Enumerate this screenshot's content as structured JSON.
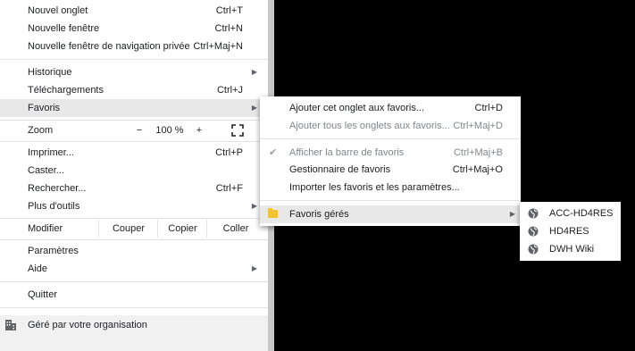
{
  "menu": {
    "new_tab": {
      "label": "Nouvel onglet",
      "shortcut": "Ctrl+T"
    },
    "new_window": {
      "label": "Nouvelle fenêtre",
      "shortcut": "Ctrl+N"
    },
    "incognito": {
      "label": "Nouvelle fenêtre de navigation privée",
      "shortcut": "Ctrl+Maj+N"
    },
    "history": {
      "label": "Historique"
    },
    "downloads": {
      "label": "Téléchargements",
      "shortcut": "Ctrl+J"
    },
    "bookmarks": {
      "label": "Favoris"
    },
    "zoom": {
      "label": "Zoom",
      "minus": "−",
      "value": "100 %",
      "plus": "+"
    },
    "print": {
      "label": "Imprimer...",
      "shortcut": "Ctrl+P"
    },
    "cast": {
      "label": "Caster..."
    },
    "find": {
      "label": "Rechercher...",
      "shortcut": "Ctrl+F"
    },
    "more_tools": {
      "label": "Plus d'outils"
    },
    "edit": {
      "label": "Modifier",
      "cut": "Couper",
      "copy": "Copier",
      "paste": "Coller"
    },
    "settings": {
      "label": "Paramètres"
    },
    "help": {
      "label": "Aide"
    },
    "quit": {
      "label": "Quitter"
    },
    "managed": {
      "label": "Géré par votre organisation"
    }
  },
  "bookmarks_submenu": {
    "add_tab": {
      "label": "Ajouter cet onglet aux favoris...",
      "shortcut": "Ctrl+D"
    },
    "add_all": {
      "label": "Ajouter tous les onglets aux favoris...",
      "shortcut": "Ctrl+Maj+D"
    },
    "show_bar": {
      "label": "Afficher la barre de favoris",
      "shortcut": "Ctrl+Maj+B"
    },
    "manager": {
      "label": "Gestionnaire de favoris",
      "shortcut": "Ctrl+Maj+O"
    },
    "import": {
      "label": "Importer les favoris et les paramètres..."
    },
    "managed_folder": {
      "label": "Favoris gérés"
    }
  },
  "managed_bookmarks": [
    {
      "label": "ACC-HD4RES"
    },
    {
      "label": "HD4RES"
    },
    {
      "label": "DWH Wiki"
    }
  ]
}
